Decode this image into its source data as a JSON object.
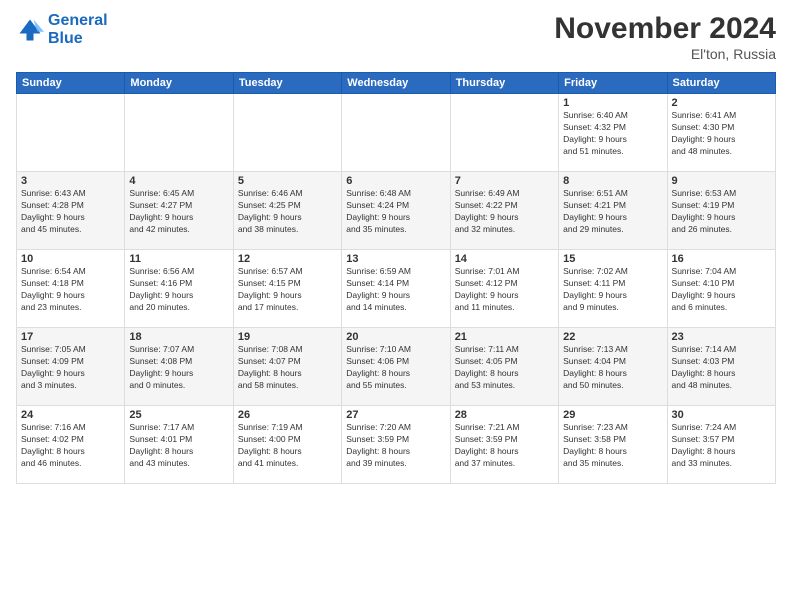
{
  "header": {
    "logo_line1": "General",
    "logo_line2": "Blue",
    "month_title": "November 2024",
    "location": "El'ton, Russia"
  },
  "weekdays": [
    "Sunday",
    "Monday",
    "Tuesday",
    "Wednesday",
    "Thursday",
    "Friday",
    "Saturday"
  ],
  "weeks": [
    [
      {
        "day": "",
        "info": ""
      },
      {
        "day": "",
        "info": ""
      },
      {
        "day": "",
        "info": ""
      },
      {
        "day": "",
        "info": ""
      },
      {
        "day": "",
        "info": ""
      },
      {
        "day": "1",
        "info": "Sunrise: 6:40 AM\nSunset: 4:32 PM\nDaylight: 9 hours\nand 51 minutes."
      },
      {
        "day": "2",
        "info": "Sunrise: 6:41 AM\nSunset: 4:30 PM\nDaylight: 9 hours\nand 48 minutes."
      }
    ],
    [
      {
        "day": "3",
        "info": "Sunrise: 6:43 AM\nSunset: 4:28 PM\nDaylight: 9 hours\nand 45 minutes."
      },
      {
        "day": "4",
        "info": "Sunrise: 6:45 AM\nSunset: 4:27 PM\nDaylight: 9 hours\nand 42 minutes."
      },
      {
        "day": "5",
        "info": "Sunrise: 6:46 AM\nSunset: 4:25 PM\nDaylight: 9 hours\nand 38 minutes."
      },
      {
        "day": "6",
        "info": "Sunrise: 6:48 AM\nSunset: 4:24 PM\nDaylight: 9 hours\nand 35 minutes."
      },
      {
        "day": "7",
        "info": "Sunrise: 6:49 AM\nSunset: 4:22 PM\nDaylight: 9 hours\nand 32 minutes."
      },
      {
        "day": "8",
        "info": "Sunrise: 6:51 AM\nSunset: 4:21 PM\nDaylight: 9 hours\nand 29 minutes."
      },
      {
        "day": "9",
        "info": "Sunrise: 6:53 AM\nSunset: 4:19 PM\nDaylight: 9 hours\nand 26 minutes."
      }
    ],
    [
      {
        "day": "10",
        "info": "Sunrise: 6:54 AM\nSunset: 4:18 PM\nDaylight: 9 hours\nand 23 minutes."
      },
      {
        "day": "11",
        "info": "Sunrise: 6:56 AM\nSunset: 4:16 PM\nDaylight: 9 hours\nand 20 minutes."
      },
      {
        "day": "12",
        "info": "Sunrise: 6:57 AM\nSunset: 4:15 PM\nDaylight: 9 hours\nand 17 minutes."
      },
      {
        "day": "13",
        "info": "Sunrise: 6:59 AM\nSunset: 4:14 PM\nDaylight: 9 hours\nand 14 minutes."
      },
      {
        "day": "14",
        "info": "Sunrise: 7:01 AM\nSunset: 4:12 PM\nDaylight: 9 hours\nand 11 minutes."
      },
      {
        "day": "15",
        "info": "Sunrise: 7:02 AM\nSunset: 4:11 PM\nDaylight: 9 hours\nand 9 minutes."
      },
      {
        "day": "16",
        "info": "Sunrise: 7:04 AM\nSunset: 4:10 PM\nDaylight: 9 hours\nand 6 minutes."
      }
    ],
    [
      {
        "day": "17",
        "info": "Sunrise: 7:05 AM\nSunset: 4:09 PM\nDaylight: 9 hours\nand 3 minutes."
      },
      {
        "day": "18",
        "info": "Sunrise: 7:07 AM\nSunset: 4:08 PM\nDaylight: 9 hours\nand 0 minutes."
      },
      {
        "day": "19",
        "info": "Sunrise: 7:08 AM\nSunset: 4:07 PM\nDaylight: 8 hours\nand 58 minutes."
      },
      {
        "day": "20",
        "info": "Sunrise: 7:10 AM\nSunset: 4:06 PM\nDaylight: 8 hours\nand 55 minutes."
      },
      {
        "day": "21",
        "info": "Sunrise: 7:11 AM\nSunset: 4:05 PM\nDaylight: 8 hours\nand 53 minutes."
      },
      {
        "day": "22",
        "info": "Sunrise: 7:13 AM\nSunset: 4:04 PM\nDaylight: 8 hours\nand 50 minutes."
      },
      {
        "day": "23",
        "info": "Sunrise: 7:14 AM\nSunset: 4:03 PM\nDaylight: 8 hours\nand 48 minutes."
      }
    ],
    [
      {
        "day": "24",
        "info": "Sunrise: 7:16 AM\nSunset: 4:02 PM\nDaylight: 8 hours\nand 46 minutes."
      },
      {
        "day": "25",
        "info": "Sunrise: 7:17 AM\nSunset: 4:01 PM\nDaylight: 8 hours\nand 43 minutes."
      },
      {
        "day": "26",
        "info": "Sunrise: 7:19 AM\nSunset: 4:00 PM\nDaylight: 8 hours\nand 41 minutes."
      },
      {
        "day": "27",
        "info": "Sunrise: 7:20 AM\nSunset: 3:59 PM\nDaylight: 8 hours\nand 39 minutes."
      },
      {
        "day": "28",
        "info": "Sunrise: 7:21 AM\nSunset: 3:59 PM\nDaylight: 8 hours\nand 37 minutes."
      },
      {
        "day": "29",
        "info": "Sunrise: 7:23 AM\nSunset: 3:58 PM\nDaylight: 8 hours\nand 35 minutes."
      },
      {
        "day": "30",
        "info": "Sunrise: 7:24 AM\nSunset: 3:57 PM\nDaylight: 8 hours\nand 33 minutes."
      }
    ]
  ]
}
